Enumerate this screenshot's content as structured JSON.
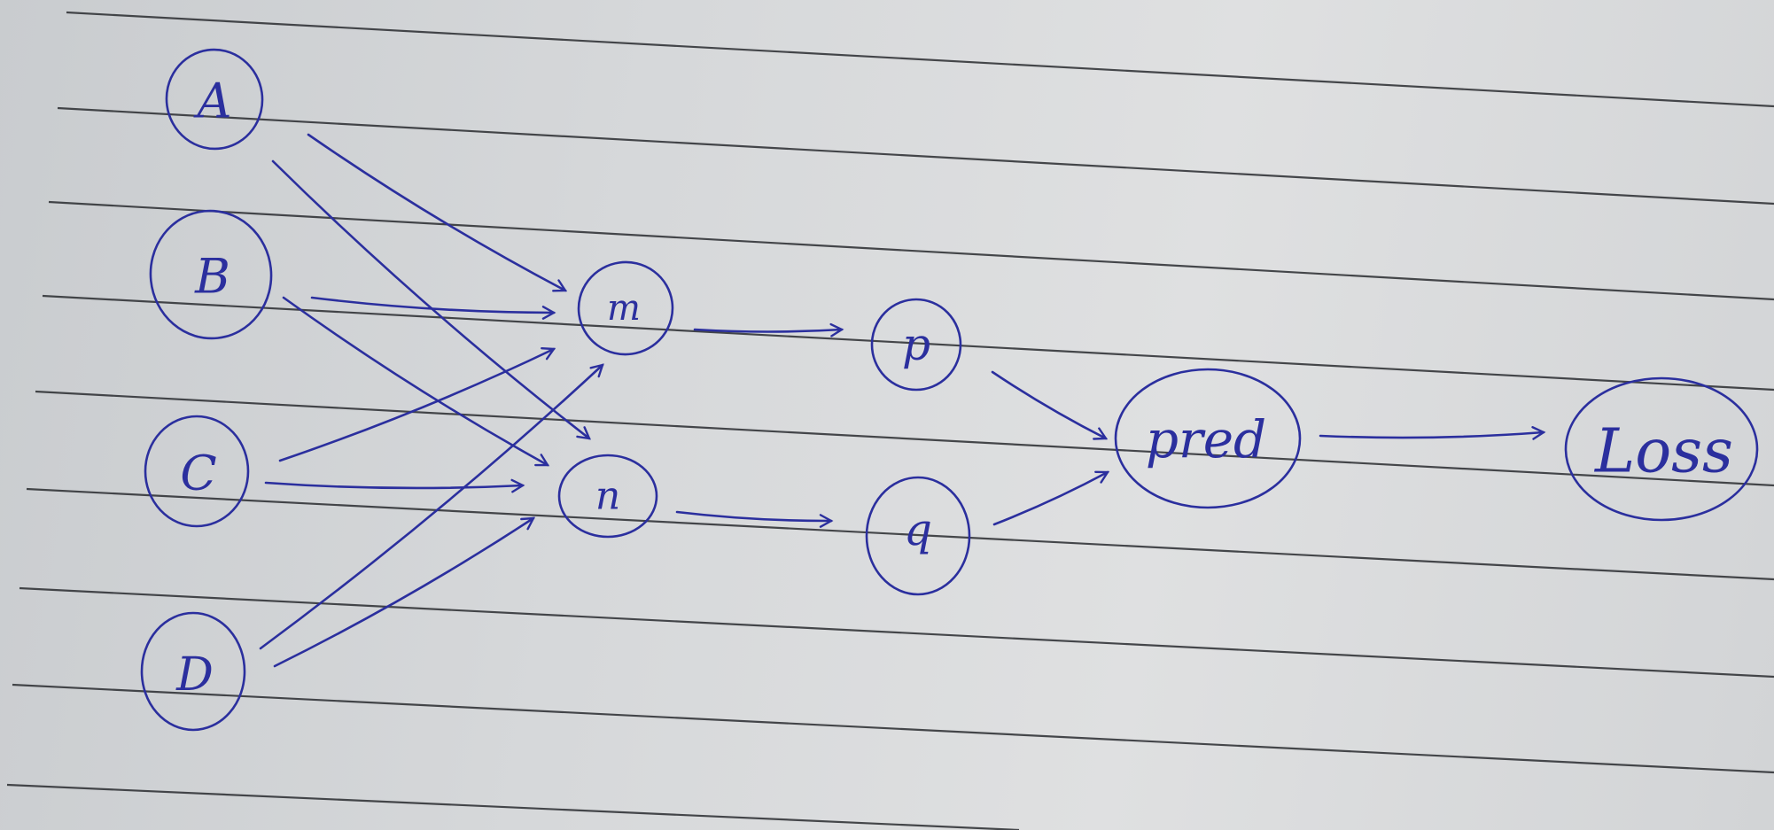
{
  "diagram": {
    "nodes": [
      {
        "id": "A",
        "label": "A"
      },
      {
        "id": "B",
        "label": "B"
      },
      {
        "id": "C",
        "label": "C"
      },
      {
        "id": "D",
        "label": "D"
      },
      {
        "id": "m",
        "label": "m"
      },
      {
        "id": "n",
        "label": "n"
      },
      {
        "id": "p",
        "label": "p"
      },
      {
        "id": "q",
        "label": "q"
      },
      {
        "id": "pred",
        "label": "pred"
      },
      {
        "id": "loss",
        "label": "Loss"
      }
    ],
    "edges": [
      {
        "from": "A",
        "to": "m"
      },
      {
        "from": "A",
        "to": "n"
      },
      {
        "from": "B",
        "to": "m"
      },
      {
        "from": "B",
        "to": "n"
      },
      {
        "from": "C",
        "to": "m"
      },
      {
        "from": "C",
        "to": "n"
      },
      {
        "from": "D",
        "to": "m"
      },
      {
        "from": "D",
        "to": "n"
      },
      {
        "from": "m",
        "to": "p"
      },
      {
        "from": "n",
        "to": "q"
      },
      {
        "from": "p",
        "to": "pred"
      },
      {
        "from": "q",
        "to": "pred"
      },
      {
        "from": "pred",
        "to": "loss"
      }
    ],
    "colors": {
      "ink": "#2b2f9e",
      "rule": "#2a2c30",
      "paper": "#d6d8da"
    }
  }
}
